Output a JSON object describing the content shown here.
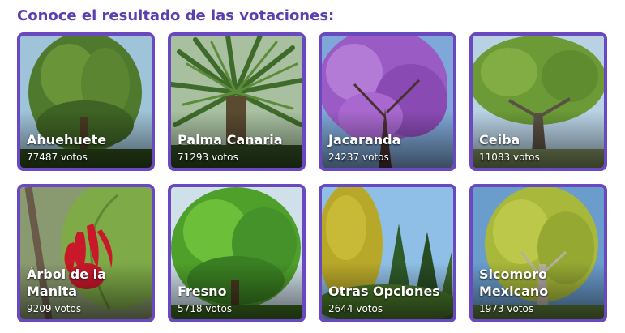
{
  "heading": "Conoce el resultado de las votaciones:",
  "colors": {
    "accent": "#6a48c0",
    "heading": "#5a3fb0"
  },
  "trees": [
    {
      "name": "Ahuehuete",
      "votes": "77487 votos"
    },
    {
      "name": "Palma Canaria",
      "votes": "71293 votos"
    },
    {
      "name": "Jacaranda",
      "votes": "24237 votos"
    },
    {
      "name": "Ceiba",
      "votes": "11083 votos"
    },
    {
      "name": "Árbol de la Manita",
      "votes": "9209 votos"
    },
    {
      "name": "Fresno",
      "votes": "5718 votos"
    },
    {
      "name": "Otras Opciones",
      "votes": "2644 votos"
    },
    {
      "name": "Sicomoro Mexicano",
      "votes": "1973 votos"
    }
  ]
}
